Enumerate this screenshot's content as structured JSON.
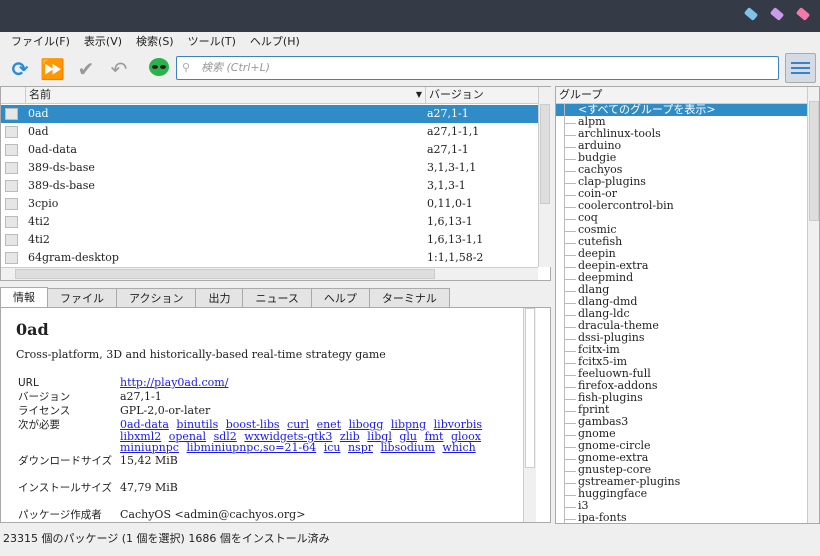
{
  "colors": {
    "titlebar": "#353a47",
    "accent": "#308cc6"
  },
  "menu": [
    "ファイル(F)",
    "表示(V)",
    "検索(S)",
    "ツール(T)",
    "ヘルプ(H)"
  ],
  "toolbar": {
    "search_placeholder": "検索 (Ctrl+L)"
  },
  "columns": {
    "name": "名前",
    "version": "バージョン"
  },
  "packages": [
    {
      "name": "0ad",
      "version": "a27,1-1"
    },
    {
      "name": "0ad",
      "version": "a27,1-1,1"
    },
    {
      "name": "0ad-data",
      "version": "a27,1-1"
    },
    {
      "name": "389-ds-base",
      "version": "3,1,3-1,1"
    },
    {
      "name": "389-ds-base",
      "version": "3,1,3-1"
    },
    {
      "name": "3cpio",
      "version": "0,11,0-1"
    },
    {
      "name": "4ti2",
      "version": "1,6,13-1"
    },
    {
      "name": "4ti2",
      "version": "1,6,13-1,1"
    },
    {
      "name": "64gram-desktop",
      "version": "1:1,1,58-2"
    }
  ],
  "tabs": [
    "情報",
    "ファイル",
    "アクション",
    "出力",
    "ニュース",
    "ヘルプ",
    "ターミナル"
  ],
  "info": {
    "title": "0ad",
    "description": "Cross-platform, 3D and historically-based real-time strategy game",
    "url_label": "URL",
    "url": "http://play0ad.com/",
    "version_label": "バージョン",
    "version": "a27,1-1",
    "license_label": "ライセンス",
    "license": "GPL-2,0-or-later",
    "depends_label": "次が必要",
    "depends": [
      "0ad-data",
      "binutils",
      "boost-libs",
      "curl",
      "enet",
      "libogg",
      "libpng",
      "libvorbis",
      "libxml2",
      "openal",
      "sdl2",
      "wxwidgets-gtk3",
      "zlib",
      "libgl",
      "glu",
      "fmt",
      "gloox",
      "miniupnpc",
      "libminiupnpc,so=21-64",
      "icu",
      "nspr",
      "libsodium",
      "which"
    ],
    "download_label": "ダウンロードサイズ",
    "download": "15,42 MiB",
    "install_label": "インストールサイズ",
    "install": "47,79 MiB",
    "packager_label": "パッケージ作成者",
    "packager": "CachyOS <admin@cachyos.org>"
  },
  "groups_header": "グループ",
  "groups": [
    "<すべてのグループを表示>",
    "alpm",
    "archlinux-tools",
    "arduino",
    "budgie",
    "cachyos",
    "clap-plugins",
    "coin-or",
    "coolercontrol-bin",
    "coq",
    "cosmic",
    "cutefish",
    "deepin",
    "deepin-extra",
    "deepmind",
    "dlang",
    "dlang-dmd",
    "dlang-ldc",
    "dracula-theme",
    "dssi-plugins",
    "fcitx-im",
    "fcitx5-im",
    "feeluown-full",
    "firefox-addons",
    "fish-plugins",
    "fprint",
    "gambas3",
    "gnome",
    "gnome-circle",
    "gnome-extra",
    "gnustep-core",
    "gstreamer-plugins",
    "huggingface",
    "i3",
    "ipa-fonts"
  ],
  "status": "23315 個のパッケージ (1 個を選択)  1686 個をインストール済み"
}
